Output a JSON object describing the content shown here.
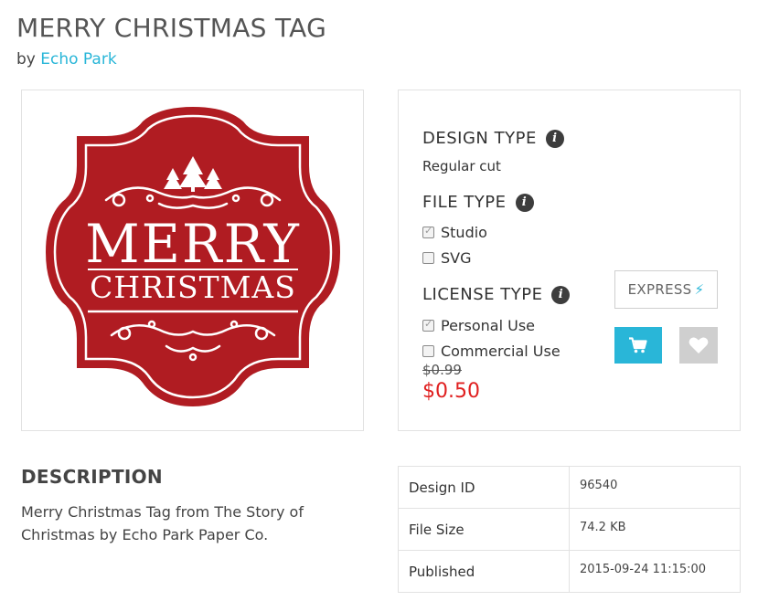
{
  "product": {
    "title": "MERRY CHRISTMAS TAG",
    "by_prefix": "by",
    "designer": "Echo Park"
  },
  "artwork": {
    "line1": "MERRY",
    "line2": "CHRISTMAS",
    "tag_color": "#b01c22"
  },
  "options": {
    "design_type": {
      "heading": "DESIGN TYPE",
      "value": "Regular cut"
    },
    "file_type": {
      "heading": "FILE TYPE",
      "items": [
        {
          "label": "Studio",
          "checked": true
        },
        {
          "label": "SVG",
          "checked": false
        }
      ]
    },
    "license_type": {
      "heading": "LICENSE TYPE",
      "items": [
        {
          "label": "Personal Use",
          "checked": true
        },
        {
          "label": "Commercial Use",
          "checked": false
        }
      ]
    },
    "price_old": "$0.99",
    "price_new": "$0.50"
  },
  "actions": {
    "express_label": "EXPRESS",
    "accent_color": "#29b6d8"
  },
  "description": {
    "heading": "DESCRIPTION",
    "text": "Merry Christmas Tag from The Story of Christmas by Echo Park Paper Co."
  },
  "details": [
    {
      "label": "Design ID",
      "value": "96540"
    },
    {
      "label": "File Size",
      "value": "74.2 KB"
    },
    {
      "label": "Published",
      "value": "2015-09-24 11:15:00"
    }
  ]
}
